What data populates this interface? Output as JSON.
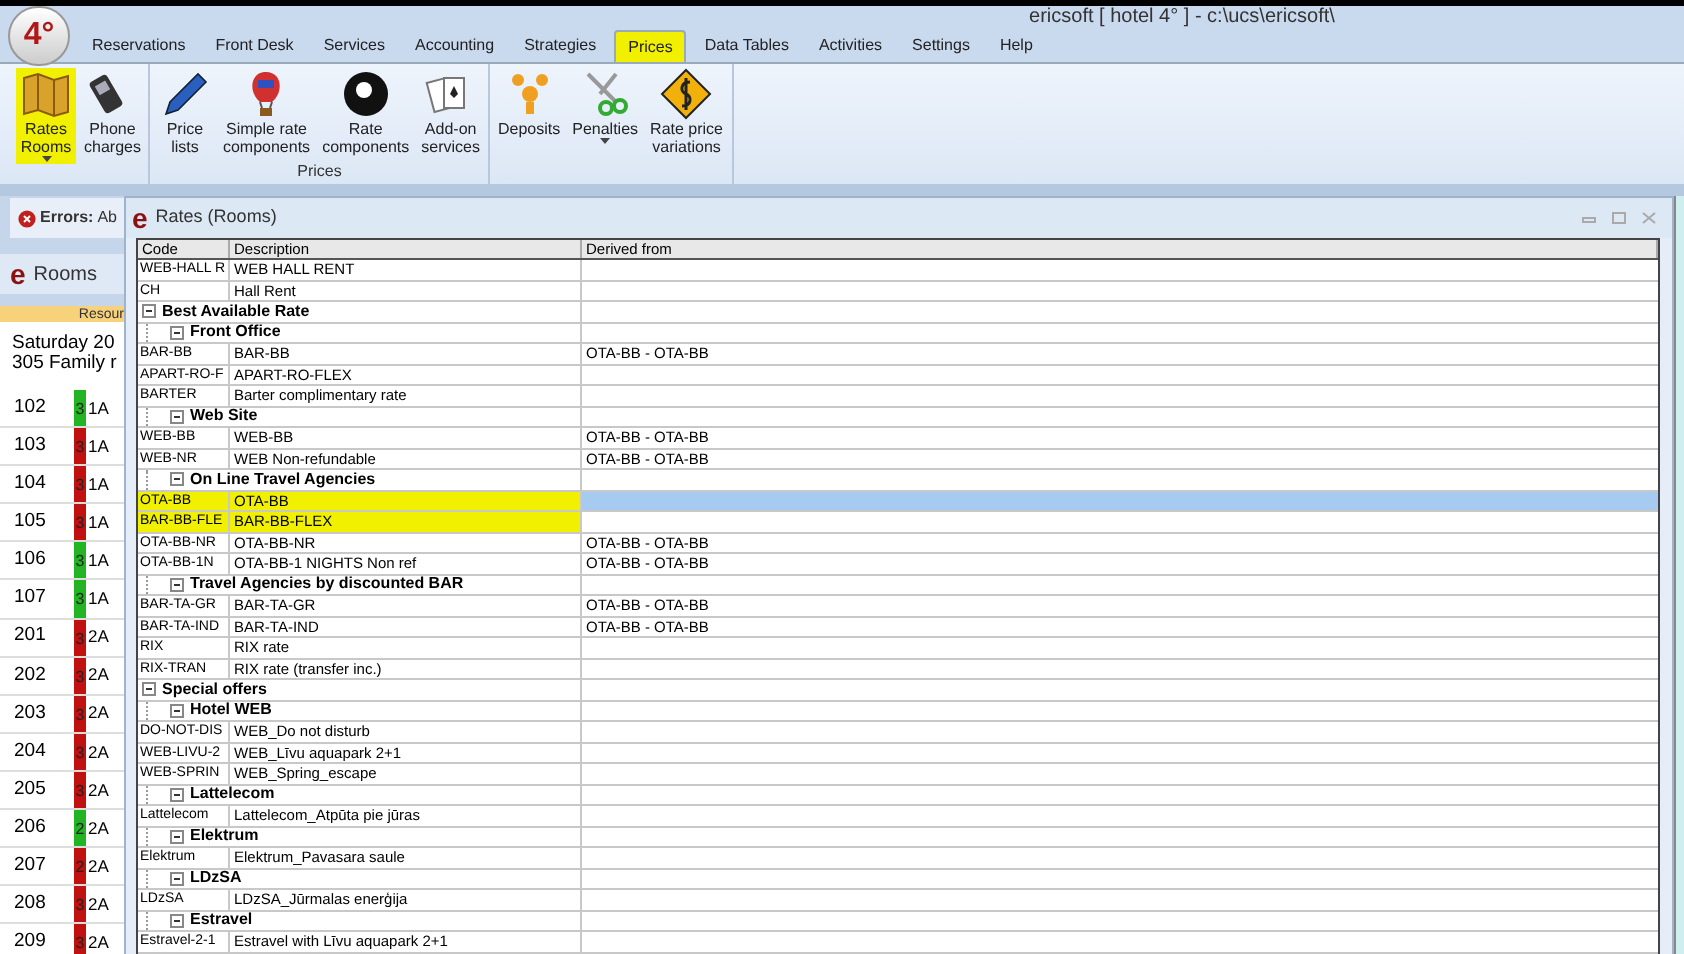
{
  "window": {
    "title": "ericsoft [ hotel 4° ] - c:\\ucs\\ericsoft\\",
    "logo": "4°"
  },
  "menu": [
    {
      "label": "Reservations",
      "selected": false,
      "highlighted": false
    },
    {
      "label": "Front Desk",
      "selected": false,
      "highlighted": false
    },
    {
      "label": "Services",
      "selected": false,
      "highlighted": false
    },
    {
      "label": "Accounting",
      "selected": false,
      "highlighted": false
    },
    {
      "label": "Strategies",
      "selected": false,
      "highlighted": false
    },
    {
      "label": "Prices",
      "selected": true,
      "highlighted": true
    },
    {
      "label": "Data Tables",
      "selected": false,
      "highlighted": false
    },
    {
      "label": "Activities",
      "selected": false,
      "highlighted": false
    },
    {
      "label": "Settings",
      "selected": false,
      "highlighted": false
    },
    {
      "label": "Help",
      "selected": false,
      "highlighted": false
    }
  ],
  "ribbon": [
    {
      "buttons": [
        {
          "kind": "map",
          "lines": [
            "Rates",
            "Rooms"
          ],
          "dropdown": true,
          "highlighted": true
        },
        {
          "kind": "phone",
          "lines": [
            "Phone",
            "charges"
          ],
          "dropdown": false,
          "highlighted": false
        }
      ]
    },
    {
      "label": "Prices",
      "buttons": [
        {
          "kind": "pen",
          "lines": [
            "Price",
            "lists"
          ],
          "dropdown": false,
          "highlighted": false
        },
        {
          "kind": "balloon",
          "lines": [
            "Simple rate",
            "components"
          ],
          "dropdown": false,
          "highlighted": false
        },
        {
          "kind": "ball",
          "lines": [
            "Rate",
            "components"
          ],
          "dropdown": false,
          "highlighted": false
        },
        {
          "kind": "cards",
          "lines": [
            "Add-on",
            "services"
          ],
          "dropdown": false,
          "highlighted": false
        }
      ]
    },
    {
      "buttons": [
        {
          "kind": "coins",
          "lines": [
            "Deposits"
          ],
          "dropdown": false,
          "highlighted": false
        },
        {
          "kind": "scissors",
          "lines": [
            "Penalties"
          ],
          "dropdown": true,
          "highlighted": false
        },
        {
          "kind": "sign",
          "lines": [
            "Rate price",
            "variations"
          ],
          "dropdown": false,
          "highlighted": false
        }
      ]
    }
  ],
  "errors_bar": {
    "label": "Errors:",
    "text": "Ab"
  },
  "rooms_panel": {
    "icon_letter": "e",
    "title": "Rooms",
    "column_header": "Resour",
    "date": "Saturday 20",
    "room_type": "305 Family r",
    "rooms": [
      {
        "number": "102",
        "count": "3",
        "color": "#22b422",
        "type": "1A"
      },
      {
        "number": "103",
        "count": "3",
        "color": "#c01010",
        "type": "1A"
      },
      {
        "number": "104",
        "count": "3",
        "color": "#c01010",
        "type": "1A"
      },
      {
        "number": "105",
        "count": "3",
        "color": "#c01010",
        "type": "1A"
      },
      {
        "number": "106",
        "count": "3",
        "color": "#22b422",
        "type": "1A"
      },
      {
        "number": "107",
        "count": "3",
        "color": "#22b422",
        "type": "1A"
      },
      {
        "number": "201",
        "count": "3",
        "color": "#c01010",
        "type": "2A"
      },
      {
        "number": "202",
        "count": "3",
        "color": "#c01010",
        "type": "2A"
      },
      {
        "number": "203",
        "count": "3",
        "color": "#c01010",
        "type": "2A"
      },
      {
        "number": "204",
        "count": "3",
        "color": "#c01010",
        "type": "2A"
      },
      {
        "number": "205",
        "count": "3",
        "color": "#c01010",
        "type": "2A"
      },
      {
        "number": "206",
        "count": "2",
        "color": "#22b422",
        "type": "2A"
      },
      {
        "number": "207",
        "count": "2",
        "color": "#c01010",
        "type": "2A"
      },
      {
        "number": "208",
        "count": "3",
        "color": "#c01010",
        "type": "2A"
      },
      {
        "number": "209",
        "count": "3",
        "color": "#c01010",
        "type": "2A"
      }
    ]
  },
  "rates_window": {
    "icon_letter": "e",
    "title": "Rates (Rooms)",
    "columns": [
      "Code",
      "Description",
      "Derived from"
    ],
    "rows": [
      {
        "kind": "rate",
        "code": "WEB-HALL R",
        "description": "WEB HALL RENT",
        "selected": false,
        "highlighted": false
      },
      {
        "kind": "rate",
        "code": "CH",
        "description": "Hall Rent",
        "selected": false,
        "highlighted": false
      },
      {
        "kind": "group",
        "label": "Best Available Rate",
        "expanded": true,
        "children": [
          {
            "kind": "group",
            "label": "Front Office",
            "expanded": true,
            "children": [
              {
                "kind": "rate",
                "code": "BAR-BB",
                "description": "BAR-BB",
                "derived_from": "OTA-BB - OTA-BB",
                "selected": false,
                "highlighted": false
              },
              {
                "kind": "rate",
                "code": "APART-RO-F",
                "description": "APART-RO-FLEX",
                "selected": false,
                "highlighted": false
              },
              {
                "kind": "rate",
                "code": "BARTER",
                "description": "Barter complimentary rate",
                "selected": false,
                "highlighted": false
              }
            ]
          },
          {
            "kind": "group",
            "label": "Web Site",
            "expanded": true,
            "children": [
              {
                "kind": "rate",
                "code": "WEB-BB",
                "description": "WEB-BB",
                "derived_from": "OTA-BB - OTA-BB",
                "selected": false,
                "highlighted": false
              },
              {
                "kind": "rate",
                "code": "WEB-NR",
                "description": "WEB Non-refundable",
                "derived_from": "OTA-BB - OTA-BB",
                "selected": false,
                "highlighted": false
              }
            ]
          },
          {
            "kind": "group",
            "label": "On Line Travel Agencies",
            "expanded": true,
            "children": [
              {
                "kind": "rate",
                "code": "OTA-BB",
                "description": "OTA-BB",
                "selected": true,
                "highlighted": true
              },
              {
                "kind": "rate",
                "code": "BAR-BB-FLE",
                "description": "BAR-BB-FLEX",
                "selected": false,
                "highlighted": true
              },
              {
                "kind": "rate",
                "code": "OTA-BB-NR",
                "description": "OTA-BB-NR",
                "derived_from": "OTA-BB - OTA-BB",
                "selected": false,
                "highlighted": false
              },
              {
                "kind": "rate",
                "code": "OTA-BB-1N",
                "description": "OTA-BB-1 NIGHTS Non ref",
                "derived_from": "OTA-BB - OTA-BB",
                "selected": false,
                "highlighted": false
              }
            ]
          },
          {
            "kind": "group",
            "label": "Travel Agencies by discounted BAR",
            "expanded": true,
            "children": [
              {
                "kind": "rate",
                "code": "BAR-TA-GR",
                "description": "BAR-TA-GR",
                "derived_from": "OTA-BB - OTA-BB",
                "selected": false,
                "highlighted": false
              },
              {
                "kind": "rate",
                "code": "BAR-TA-IND",
                "description": "BAR-TA-IND",
                "derived_from": "OTA-BB - OTA-BB",
                "selected": false,
                "highlighted": false
              },
              {
                "kind": "rate",
                "code": "RIX",
                "description": "RIX rate",
                "selected": false,
                "highlighted": false
              },
              {
                "kind": "rate",
                "code": "RIX-TRAN",
                "description": "RIX rate (transfer inc.)",
                "selected": false,
                "highlighted": false
              }
            ]
          }
        ]
      },
      {
        "kind": "group",
        "label": "Special offers",
        "expanded": true,
        "children": [
          {
            "kind": "group",
            "label": "Hotel WEB",
            "expanded": true,
            "children": [
              {
                "kind": "rate",
                "code": "DO-NOT-DIS",
                "description": "WEB_Do not disturb",
                "selected": false,
                "highlighted": false
              },
              {
                "kind": "rate",
                "code": "WEB-LIVU-2",
                "description": "WEB_Līvu aquapark 2+1",
                "selected": false,
                "highlighted": false
              },
              {
                "kind": "rate",
                "code": "WEB-SPRIN",
                "description": "WEB_Spring_escape",
                "selected": false,
                "highlighted": false
              }
            ]
          },
          {
            "kind": "group",
            "label": "Lattelecom",
            "expanded": true,
            "children": [
              {
                "kind": "rate",
                "code": "Lattelecom",
                "description": "Lattelecom_Atpūta pie jūras",
                "selected": false,
                "highlighted": false
              }
            ]
          },
          {
            "kind": "group",
            "label": "Elektrum",
            "expanded": true,
            "children": [
              {
                "kind": "rate",
                "code": "Elektrum",
                "description": "Elektrum_Pavasara saule",
                "selected": false,
                "highlighted": false
              }
            ]
          },
          {
            "kind": "group",
            "label": "LDzSA",
            "expanded": true,
            "children": [
              {
                "kind": "rate",
                "code": "LDzSA",
                "description": "LDzSA_Jūrmalas enerģija",
                "selected": false,
                "highlighted": false
              }
            ]
          },
          {
            "kind": "group",
            "label": "Estravel",
            "expanded": true,
            "children": [
              {
                "kind": "rate",
                "code": "Estravel-2-1",
                "description": "Estravel with Līvu aquapark 2+1",
                "selected": false,
                "highlighted": false
              }
            ]
          }
        ]
      }
    ]
  }
}
